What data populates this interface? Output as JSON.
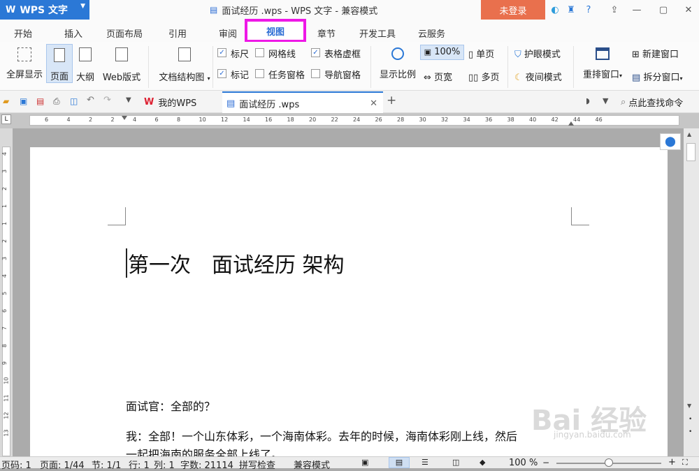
{
  "app": {
    "name": "WPS 文字",
    "logo": "W",
    "title": "面试经历 .wps - WPS 文字 - 兼容模式",
    "login_label": "未登录"
  },
  "menu_tabs": [
    "开始",
    "插入",
    "页面布局",
    "引用",
    "审阅",
    "视图",
    "章节",
    "开发工具",
    "云服务"
  ],
  "active_tab": "视图",
  "ribbon": {
    "fullscreen": "全屏显示",
    "page": "页面",
    "outline": "大纲",
    "web": "Web版式",
    "docmap": "文档结构图",
    "ruler": "标尺",
    "gridlines": "网格线",
    "table_border": "表格虚框",
    "marks": "标记",
    "task_pane": "任务窗格",
    "nav_pane": "导航窗格",
    "zoom": "显示比例",
    "zoom_100": "100%",
    "single_page": "单页",
    "page_width": "页宽",
    "multi_page": "多页",
    "eye_mode": "护眼模式",
    "night_mode": "夜间模式",
    "arrange": "重排窗口",
    "new_window": "新建窗口",
    "split_window": "拆分窗口"
  },
  "doc_tabs": {
    "my_wps": "我的WPS",
    "doc": "面试经历 .wps",
    "search": "点此查找命令"
  },
  "ruler_numbers": [
    "6",
    "4",
    "2",
    "2",
    "4",
    "6",
    "8",
    "10",
    "12",
    "14",
    "16",
    "18",
    "20",
    "22",
    "24",
    "26",
    "28",
    "30",
    "32",
    "34",
    "36",
    "38",
    "40",
    "42",
    "44",
    "46"
  ],
  "vruler_numbers": [
    "4",
    "3",
    "2",
    "1",
    "1",
    "2",
    "3",
    "4",
    "5",
    "6",
    "7",
    "8",
    "9",
    "10",
    "11",
    "12",
    "13"
  ],
  "document": {
    "heading": "第一次　面试经历 架构",
    "line1": "面试官：全部的？",
    "line2": "我：全部！一个山东体彩，一个海南体彩。去年的时候，海南体彩刚上线，然后",
    "line3": "一起把海南的服务全部上线了。"
  },
  "status": {
    "page_code": "页码: 1",
    "pages": "页面: 1/44",
    "section": "节: 1/1",
    "row": "行: 1",
    "col": "列: 1",
    "word_count": "字数: 21114",
    "spell": "拼写检查",
    "compat": "兼容模式",
    "zoom": "100 %"
  },
  "watermark": "Bai 经验",
  "watermark_sub": "jingyan.baidu.com",
  "colors": {
    "accent": "#2b78d6",
    "highlight": "#ee18e6",
    "login": "#e9704d"
  }
}
